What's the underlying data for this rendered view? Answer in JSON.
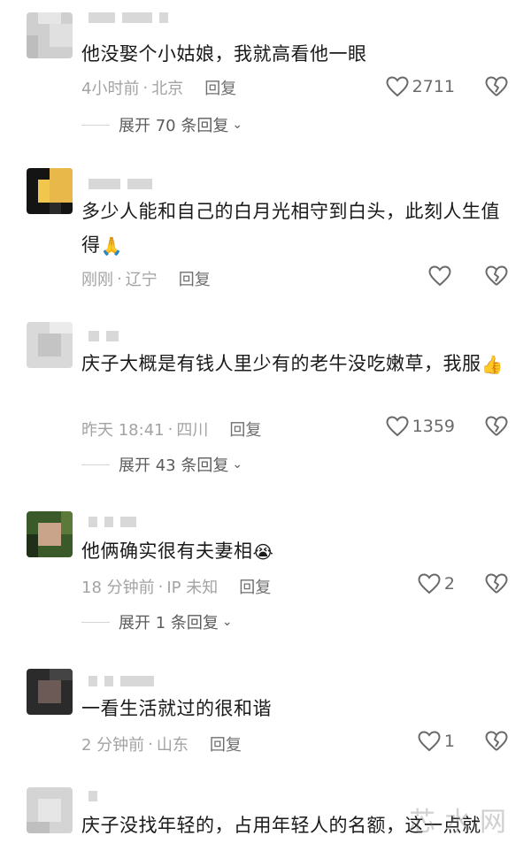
{
  "comments": [
    {
      "text": "他没娶个小姑娘，我就高看他一眼",
      "time": "4小时前",
      "location": "北京",
      "reply_label": "回复",
      "likes": "2711",
      "expand": "展开 70 条回复"
    },
    {
      "text": "多少人能和自己的白月光相守到白头，此刻人生值得",
      "emoji": "🙏",
      "time": "刚刚",
      "location": "辽宁",
      "reply_label": "回复",
      "likes": ""
    },
    {
      "text": "庆子大概是有钱人里少有的老牛没吃嫩草，我服",
      "emoji": "👍",
      "time": "昨天 18:41",
      "location": "四川",
      "reply_label": "回复",
      "likes": "1359",
      "expand": "展开 43 条回复"
    },
    {
      "text": "他俩确实很有夫妻相",
      "emoji": "😭",
      "time": "18 分钟前",
      "location": "IP 未知",
      "reply_label": "回复",
      "likes": "2",
      "expand": "展开 1 条回复"
    },
    {
      "text": "一看生活就过的很和谐",
      "time": "2 分钟前",
      "location": "山东",
      "reply_label": "回复",
      "likes": "1"
    },
    {
      "text": "庆子没找年轻的，占用年轻人的名额，这一点就"
    }
  ],
  "separator": "·",
  "watermark": "芯水网",
  "colors": {
    "text": "#1a1a1a",
    "meta": "#a3a3a3",
    "icon": "#6a6a6a"
  },
  "icons": {
    "like": "heart-outline-icon",
    "dislike": "broken-heart-icon",
    "expand": "chevron-down-icon"
  }
}
